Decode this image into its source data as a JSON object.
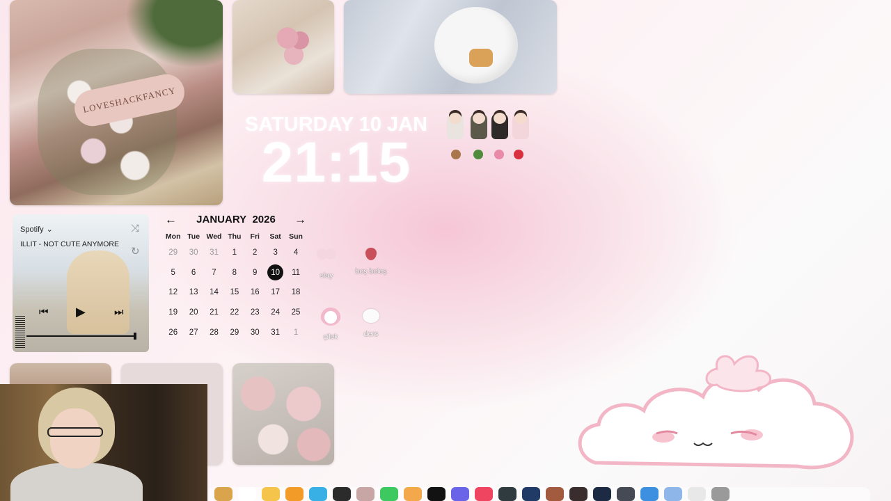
{
  "shop_photo": {
    "sign_text": "LOVESHACKFANCY"
  },
  "clock": {
    "date": "SATURDAY  10 JAN",
    "time": "21:15"
  },
  "spotify": {
    "source": "Spotify",
    "song": "ILLIT - NOT CUTE ANYMORE",
    "controls": [
      "previous",
      "play",
      "next",
      "shuffle",
      "repeat"
    ]
  },
  "calendar": {
    "month": "JANUARY",
    "year": "2026",
    "weekdays": [
      "Mon",
      "Tue",
      "Wed",
      "Thu",
      "Fri",
      "Sat",
      "Sun"
    ],
    "days": [
      {
        "n": "29",
        "muted": true
      },
      {
        "n": "30",
        "muted": true
      },
      {
        "n": "31",
        "muted": true
      },
      {
        "n": "1"
      },
      {
        "n": "2"
      },
      {
        "n": "3"
      },
      {
        "n": "4"
      },
      {
        "n": "5"
      },
      {
        "n": "6"
      },
      {
        "n": "7"
      },
      {
        "n": "8"
      },
      {
        "n": "9"
      },
      {
        "n": "10",
        "today": true
      },
      {
        "n": "11"
      },
      {
        "n": "12"
      },
      {
        "n": "13"
      },
      {
        "n": "14"
      },
      {
        "n": "15"
      },
      {
        "n": "16"
      },
      {
        "n": "17"
      },
      {
        "n": "18"
      },
      {
        "n": "19"
      },
      {
        "n": "20"
      },
      {
        "n": "21"
      },
      {
        "n": "22"
      },
      {
        "n": "23"
      },
      {
        "n": "24"
      },
      {
        "n": "25"
      },
      {
        "n": "26"
      },
      {
        "n": "27"
      },
      {
        "n": "28"
      },
      {
        "n": "29"
      },
      {
        "n": "30"
      },
      {
        "n": "31"
      },
      {
        "n": "1",
        "muted": true
      }
    ]
  },
  "desktop_icons": [
    {
      "label": "slay",
      "icon": "bow-icon"
    },
    {
      "label": "boş beleş",
      "icon": "strawberry-icon"
    },
    {
      "label": "çilek",
      "icon": "my-melody-icon"
    },
    {
      "label": "ders",
      "icon": "hello-kitty-icon"
    }
  ],
  "colors": {
    "accent_pink": "#f6c6d6",
    "today_circle": "#111111"
  }
}
